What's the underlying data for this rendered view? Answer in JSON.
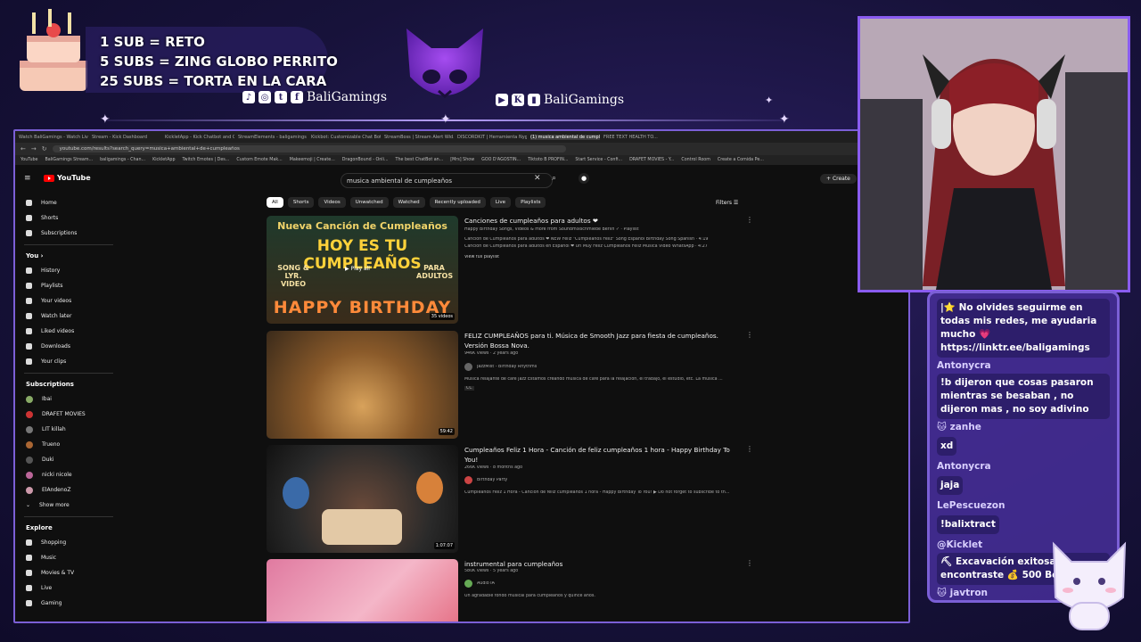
{
  "overlay": {
    "sub_lines": [
      "1 SUB = RETO",
      "5 SUBS = ZING GLOBO PERRITO",
      "25 SUBS = TORTA EN LA CARA"
    ],
    "handle_left": "BaliGamings",
    "handle_right": "BaliGamings",
    "accent": "#7b5fd6"
  },
  "browser": {
    "tabs": [
      "Watch BaliGamings - Watch Live on",
      "Stream - Kick Dashboard",
      "KickletApp - Kick Chatbot and Chat",
      "StreamElements - baligamings",
      "Kickbot: Customizable Chat Bot for",
      "StreamBoss | Stream Alert Wid...",
      "DISCORDKIT | Herramienta Nyg...",
      "(1) musica ambiental de cumple...",
      "FREE TEXT HEALTH TO..."
    ],
    "active_tab_index": 7,
    "url": "youtube.com/results?search_query=musica+ambiental+de+cumpleaños",
    "bookmarks": [
      "YouTube",
      "BaliGamings Stream...",
      "baligamings - Chan...",
      "KickletApp",
      "Twitch Emotes | Des...",
      "Custom Emote Mak...",
      "Makeemoji | Create...",
      "DragonBound - Onli...",
      "The best ChatBot an...",
      "[Mrs] Show",
      "GOO D'AGOSTIN...",
      "Tiktoto B PROFIN...",
      "Start Service - Confi...",
      "DRAFET MOVIES - Y...",
      "Control Room",
      "Create a Comida Pe..."
    ]
  },
  "youtube": {
    "logo": "YouTube",
    "search_value": "musica ambiental de cumpleaños",
    "create_label": "Create",
    "filters_label": "Filters",
    "chips": [
      "All",
      "Shorts",
      "Videos",
      "Unwatched",
      "Watched",
      "Recently uploaded",
      "Live",
      "Playlists"
    ],
    "sidebar_main": [
      "Home",
      "Shorts",
      "Subscriptions"
    ],
    "you_label": "You",
    "sidebar_you": [
      "History",
      "Playlists",
      "Your videos",
      "Watch later",
      "Liked videos",
      "Downloads",
      "Your clips"
    ],
    "subs_label": "Subscriptions",
    "subscriptions": [
      "Ibai",
      "DRAFET MOVIES",
      "LIT killah",
      "Trueno",
      "Duki",
      "nicki nicole",
      "ElAndenoZ"
    ],
    "show_more": "Show more",
    "explore_label": "Explore",
    "explore": [
      "Shopping",
      "Music",
      "Movies & TV",
      "Live",
      "Gaming"
    ],
    "results": [
      {
        "title": "Canciones de cumpleaños para adultos ❤",
        "meta1": "Happy Birthday Songs, Videos & more from Soundmixschmiede Berlin ✓ · Playlist",
        "meta2": "Canción de Cumpleaños para adultos ❤ NEW Feliz \"Cumpleaños Feliz\" Song Español Birthday Song Spanish · 4:19",
        "meta3": "Canción de Cumpleaños para adultos en Español ❤ Un Muy Feliz Cumpleaños Feliz Música Video WhatsApp · 4:27",
        "meta4": "View full playlist",
        "thumb_top": "Nueva Canción de Cumpleaños",
        "thumb_main": "HOY ES TU CUMPLEAÑOS",
        "thumb_left": "SONG & LYR. VIDEO",
        "thumb_right": "PARA ADULTOS",
        "thumb_bottom": "HAPPY BIRTHDAY",
        "play_all": "▶ Play all",
        "videos": "35 videos"
      },
      {
        "title": "FELIZ CUMPLEAÑOS para ti. Música de Smooth Jazz para fiesta de cumpleaños. Versión Bossa Nova.",
        "meta1": "946K views · 2 years ago",
        "channel": "JazzMist - Birthday Rhythms",
        "desc": "Música relajante de café jazz Estamos creando música de café para la relajación, el trabajo, el estudio, etc. La música ...",
        "badge": "CC",
        "duration": "59:42"
      },
      {
        "title": "Cumpleaños Feliz 1 Hora - Canción de feliz cumpleaños 1 hora - Happy Birthday To You!",
        "meta1": "266K views · 8 months ago",
        "channel": "Birthday Party",
        "desc": "Cumpleaños Feliz 1 Hora - Canción de feliz cumpleaños 1 hora - Happy Birthday To You! ▶ Do not forget to subscribe to th...",
        "duration": "1:07:07"
      },
      {
        "title": "instrumental para cumpleaños",
        "meta1": "580K views · 5 years ago",
        "channel": "Audio IA",
        "desc": "Un agradable fondo musical para cumpleaños y quince años."
      }
    ]
  },
  "chat": {
    "messages": [
      {
        "user": "",
        "text": "|⭐ No olvides seguirme en todas mis redes, me ayudaria mucho 💗https://linktr.ee/baligamings"
      },
      {
        "user": "Antonycra",
        "text": "!b dijeron que cosas pasaron mientras se besaban , no dijeron mas , no soy adivino"
      },
      {
        "user": "🐱 zanhe",
        "text": "xd"
      },
      {
        "user": "Antonycra",
        "text": "jaja"
      },
      {
        "user": "LePescuezon",
        "text": "!balixtract"
      },
      {
        "user": "@Kicklet",
        "text": "⛏ Excavación exitosa! encontraste 💰 500 Bo"
      },
      {
        "user": "🐱 javtron",
        "text": "😊"
      }
    ]
  }
}
